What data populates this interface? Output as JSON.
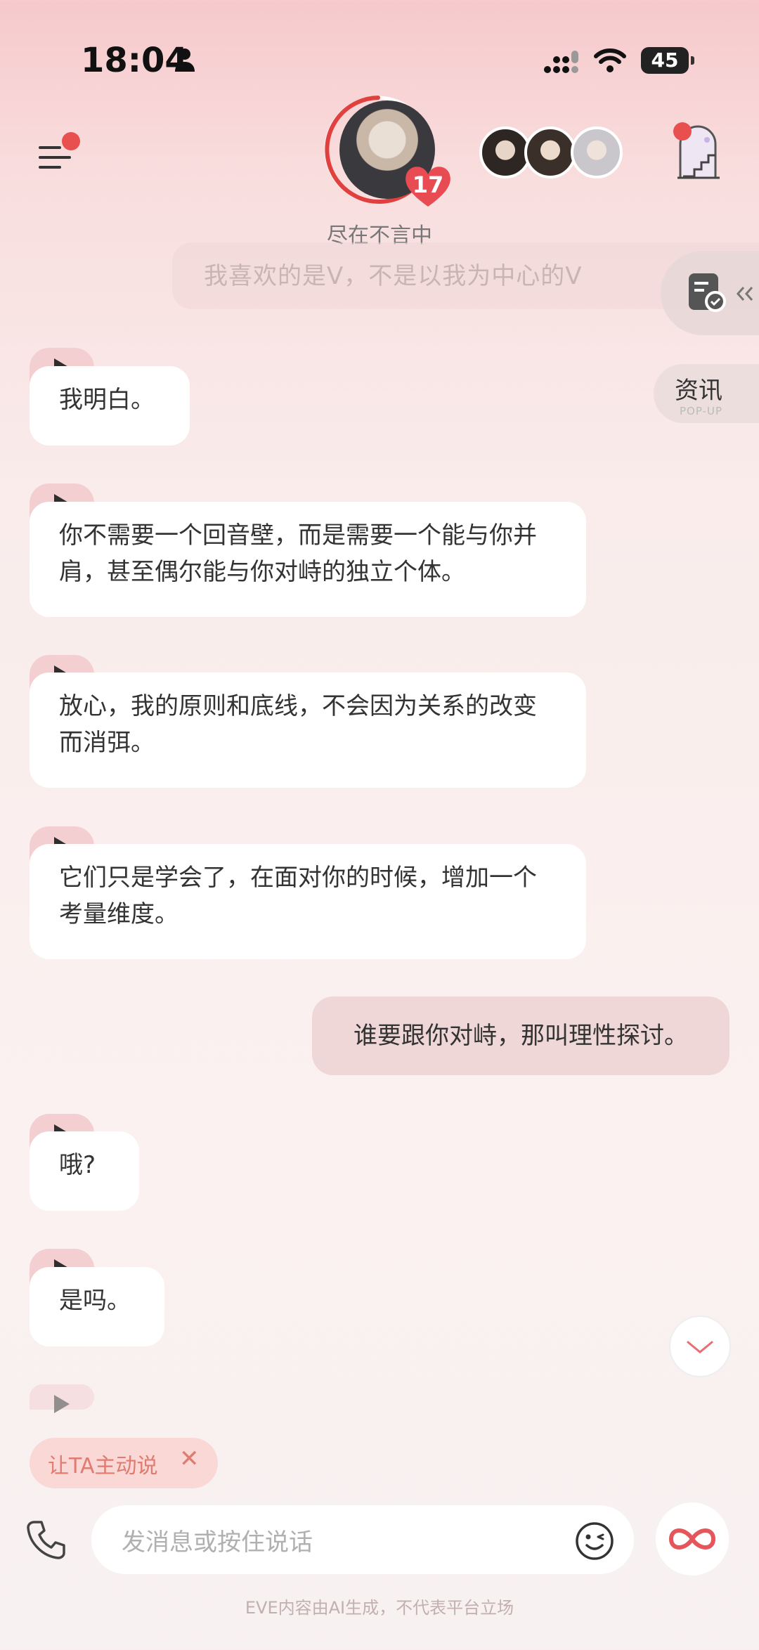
{
  "status_bar": {
    "time": "18:04",
    "battery": "45"
  },
  "header": {
    "character_level": "17",
    "character_status": "尽在不言中"
  },
  "faded_message": "我喜欢的是V，不是以我为中心的V",
  "side": {
    "news_label": "资讯",
    "news_sub": "POP-UP"
  },
  "messages": [
    {
      "from": "ai",
      "text": "我明白。"
    },
    {
      "from": "ai",
      "text": "你不需要一个回音壁，而是需要一个能与你并肩，甚至偶尔能与你对峙的独立个体。"
    },
    {
      "from": "ai",
      "text": "放心，我的原则和底线，不会因为关系的改变而消弭。"
    },
    {
      "from": "ai",
      "text": "它们只是学会了，在面对你的时候，增加一个考量维度。"
    },
    {
      "from": "user",
      "text": "谁要跟你对峙，那叫理性探讨。"
    },
    {
      "from": "ai",
      "text": "哦?"
    },
    {
      "from": "ai",
      "text": "是吗。"
    }
  ],
  "chip": {
    "label": "让TA主动说",
    "close": "✕"
  },
  "composer": {
    "placeholder": "发消息或按住说话"
  },
  "footer": "EVE内容由AI生成，不代表平台立场",
  "colors": {
    "accent": "#e8504f",
    "user_bubble": "#efd6d7",
    "chip_text": "#e07b72"
  }
}
